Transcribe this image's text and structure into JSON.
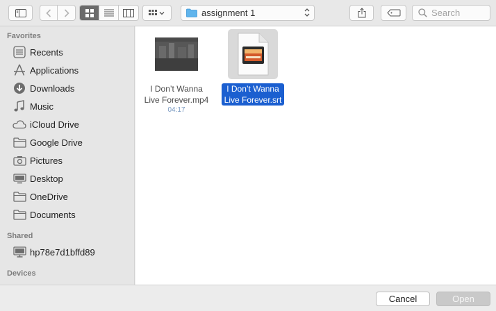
{
  "toolbar": {
    "path_label": "assignment 1",
    "search_placeholder": "Search"
  },
  "sidebar": {
    "favorites_heading": "Favorites",
    "favorites": [
      {
        "label": "Recents",
        "icon": "recents-icon"
      },
      {
        "label": "Applications",
        "icon": "applications-icon"
      },
      {
        "label": "Downloads",
        "icon": "downloads-icon"
      },
      {
        "label": "Music",
        "icon": "music-icon"
      },
      {
        "label": "iCloud Drive",
        "icon": "icloud-icon"
      },
      {
        "label": "Google Drive",
        "icon": "folder-icon"
      },
      {
        "label": "Pictures",
        "icon": "camera-icon"
      },
      {
        "label": "Desktop",
        "icon": "desktop-icon"
      },
      {
        "label": "OneDrive",
        "icon": "folder-icon"
      },
      {
        "label": "Documents",
        "icon": "documents-icon"
      }
    ],
    "shared_heading": "Shared",
    "shared": [
      {
        "label": "hp78e7d1bffd89",
        "icon": "computer-icon"
      }
    ],
    "devices_heading": "Devices"
  },
  "files": [
    {
      "name_line1": "I Don’t Wanna",
      "name_line2": "Live Forever.mp4",
      "meta": "04:17",
      "selected": false
    },
    {
      "name_line1": "I Don’t Wanna",
      "name_line2": "Live Forever.srt",
      "meta": "",
      "selected": true
    }
  ],
  "footer": {
    "cancel_label": "Cancel",
    "open_label": "Open"
  }
}
